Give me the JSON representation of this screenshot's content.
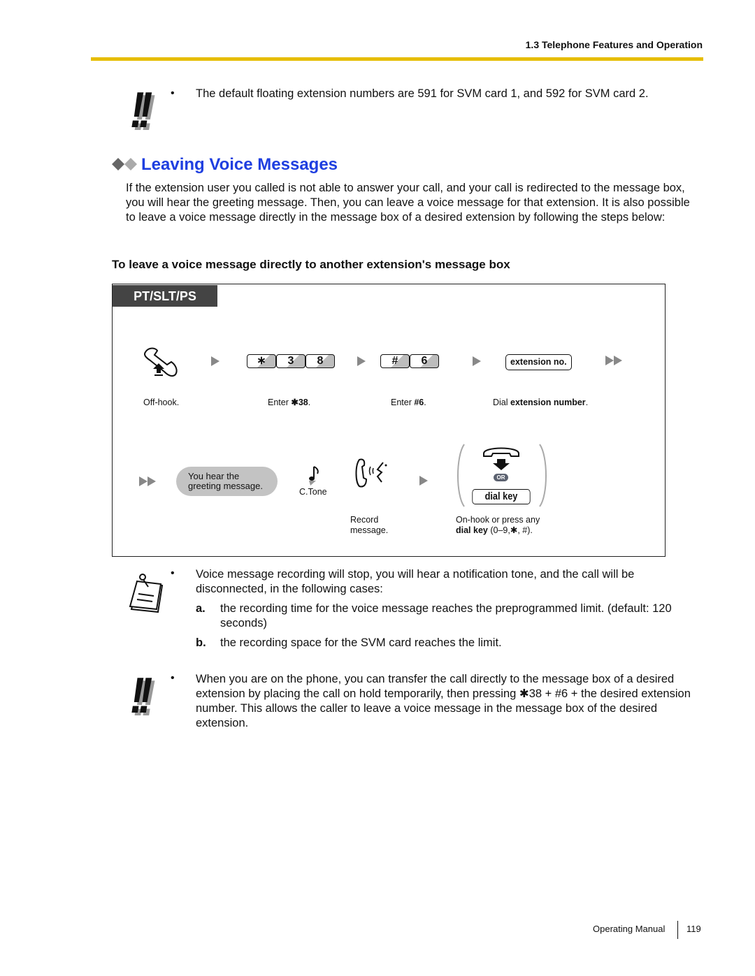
{
  "header": {
    "section": "1.3 Telephone Features and Operation",
    "accent_color": "#e6bd00"
  },
  "notice_top": {
    "icon": "double-exclamation-icon",
    "text": "The default floating extension numbers are 591 for SVM card 1, and 592 for SVM card 2."
  },
  "section": {
    "title": "Leaving Voice Messages",
    "title_color": "#1f3fe0",
    "icon": "double-diamond-icon",
    "intro": "If the extension user you called is not able to answer your call, and your call is redirected to the message box, you will hear the greeting message. Then, you can leave a voice message for that extension. It is also possible to leave a voice message directly in the message box of a desired extension by following the steps below:",
    "subtitle": "To leave a voice message directly to another extension's message box"
  },
  "procedure": {
    "tab": "PT/SLT/PS",
    "row1": {
      "step1": {
        "icon": "off-hook-icon",
        "caption": "Off-hook."
      },
      "step2": {
        "keys": [
          "∗",
          "3",
          "8"
        ],
        "caption_pre": "Enter ",
        "caption_bold": "✱38",
        "caption_post": "."
      },
      "step3": {
        "keys": [
          "#",
          "6"
        ],
        "caption_pre": "Enter ",
        "caption_bold": "#6",
        "caption_post": "."
      },
      "step4": {
        "box": "extension no.",
        "caption_pre": "Dial ",
        "caption_bold": "extension number",
        "caption_post": "."
      }
    },
    "row2": {
      "greeting": "You hear the greeting message.",
      "greeting_line1": "You hear the",
      "greeting_line2": "greeting message.",
      "tone": {
        "icon": "confirmation-tone-icon",
        "label": "C.Tone"
      },
      "record": {
        "icon": "talk-into-handset-icon",
        "caption_line1": "Record",
        "caption_line2": "message."
      },
      "end": {
        "icon": "on-hook-icon",
        "or_label": "OR",
        "box": "dial key",
        "caption_line1": "On-hook or press any",
        "caption_bold": "dial key",
        "caption_post": " (0–9,✱, #)."
      }
    }
  },
  "note": {
    "icon": "memo-note-icon",
    "text": "Voice message recording will stop, you will hear a notification tone, and the call will be disconnected, in the following cases:",
    "cases": [
      {
        "label": "a.",
        "text": "the recording time for the voice message reaches the preprogrammed limit. (default: 120 seconds)"
      },
      {
        "label": "b.",
        "text": "the recording space for the SVM card reaches the limit."
      }
    ]
  },
  "notice_bottom": {
    "icon": "double-exclamation-icon",
    "text": "When you are on the phone, you can transfer the call directly to the message box of a desired extension by placing the call on hold temporarily, then pressing ✱38 + #6 + the desired extension number. This allows the caller to leave a voice message in the message box of the desired extension."
  },
  "footer": {
    "manual": "Operating Manual",
    "page": "119"
  }
}
